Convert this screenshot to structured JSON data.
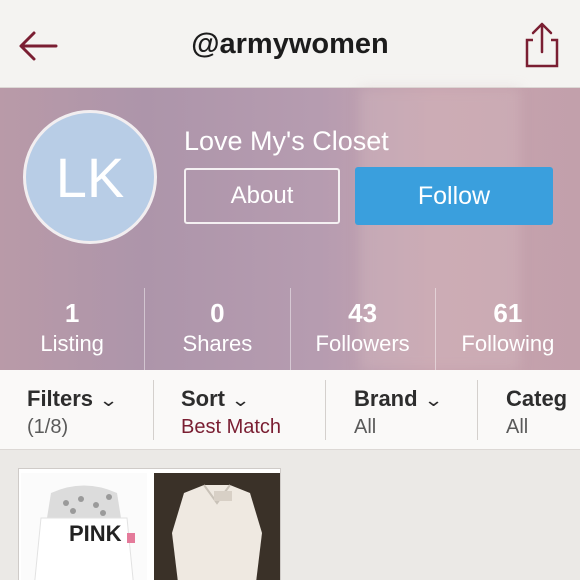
{
  "nav": {
    "title": "@armywomen"
  },
  "profile": {
    "initials": "LK",
    "closet_name": "Love My's Closet",
    "about_label": "About",
    "follow_label": "Follow"
  },
  "stats": [
    {
      "num": "1",
      "label": "Listing"
    },
    {
      "num": "0",
      "label": "Shares"
    },
    {
      "num": "43",
      "label": "Followers"
    },
    {
      "num": "61",
      "label": "Following"
    }
  ],
  "filters": [
    {
      "title": "Filters",
      "value": "(1/8)"
    },
    {
      "title": "Sort",
      "value": "Best Match"
    },
    {
      "title": "Brand",
      "value": "All"
    },
    {
      "title": "Categ",
      "value": "All"
    }
  ],
  "listing": {
    "thumb1_text": "PINK"
  },
  "colors": {
    "follow": "#3a9fdd",
    "accent": "#7a1e32"
  }
}
